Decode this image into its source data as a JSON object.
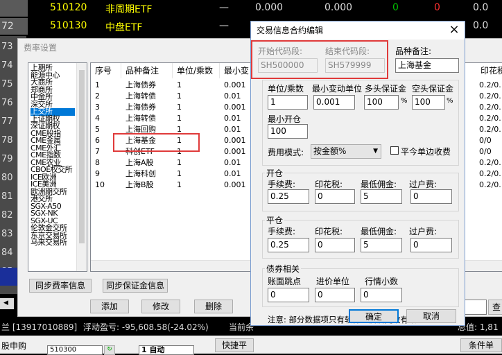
{
  "background_table": {
    "rows": [
      {
        "num": "",
        "code": "510120",
        "name": "非周期ETF",
        "c1": "—",
        "c2": "0.000",
        "c3": "0.000",
        "c4": "0",
        "c5": "0",
        "c6": "0.0"
      },
      {
        "num": "72",
        "code": "510130",
        "name": "中盘ETF",
        "c1": "—",
        "c2": "0.000",
        "c3": "",
        "c4": "",
        "c5": "",
        "c6": "0.0"
      }
    ],
    "left_numbers": [
      "73",
      "74",
      "75",
      "76",
      "77",
      "78",
      "79",
      "80",
      "81",
      "82",
      "83",
      "84",
      "85"
    ],
    "code_color": "#ffff00",
    "green": "#00c000",
    "red": "#ff3030"
  },
  "fee_window": {
    "title": "费率设置",
    "exchanges": [
      "上期所",
      "能源中心",
      "大商所",
      "郑商所",
      "中金所",
      "深交所",
      "上交所",
      "上证期权",
      "深证期权",
      "CME股指",
      "CME金属",
      "CME外汇",
      "CME指数",
      "CME农业",
      "CBOE权交所",
      "ICE欧洲",
      "ICE美洲",
      "欧洲期交所",
      "港交所",
      "SGX-A50",
      "SGX-NK",
      "SGX-UC",
      "伦敦金交所",
      "东京交易所",
      "马来交易所"
    ],
    "selected_exchange": "上交所",
    "columns": [
      "序号",
      "品种备注",
      "单位/乘数",
      "最小变"
    ],
    "rows": [
      {
        "no": "1",
        "name": "上海债券",
        "unit": "1",
        "min": "0.001"
      },
      {
        "no": "2",
        "name": "上海转债",
        "unit": "1",
        "min": "0.01"
      },
      {
        "no": "3",
        "name": "上海债券",
        "unit": "1",
        "min": "0.001"
      },
      {
        "no": "4",
        "name": "上海转债",
        "unit": "1",
        "min": "0.01"
      },
      {
        "no": "5",
        "name": "上海回购",
        "unit": "1",
        "min": "0.01"
      },
      {
        "no": "6",
        "name": "上海基金",
        "unit": "1",
        "min": "0.001"
      },
      {
        "no": "7",
        "name": "科创ETF",
        "unit": "1",
        "min": "0.001"
      },
      {
        "no": "8",
        "name": "上海A股",
        "unit": "1",
        "min": "0.01"
      },
      {
        "no": "9",
        "name": "上海科创",
        "unit": "1",
        "min": "0.01"
      },
      {
        "no": "10",
        "name": "上海B股",
        "unit": "1",
        "min": "0.001"
      }
    ],
    "right_column_header": "印花税",
    "right_column_values": [
      "0.2/0.",
      "0.2/0.",
      "0.2/0.",
      "0.2/0.",
      "0.2/0.",
      "0/0",
      "0/0",
      "0.2/0.",
      "0.2/0.",
      "0.2/0."
    ],
    "btn_sync_fee": "同步费率信息",
    "btn_sync_margin": "同步保证金信息",
    "btn_add": "添加",
    "btn_edit": "修改",
    "btn_delete": "删除",
    "btn_partial": "查"
  },
  "edit_dialog": {
    "title": "交易信息合约编辑",
    "close": "×",
    "start_code_label": "开始代码段:",
    "start_code_value": "SH500000",
    "end_code_label": "结束代码段:",
    "end_code_value": "SH579999",
    "remark_label": "品种备注:",
    "remark_value": "上海基金",
    "unit_label": "单位/乘数",
    "unit_value": "1",
    "min_change_label": "最小变动单位",
    "min_change_value": "0.001",
    "long_margin_label": "多头保证金",
    "long_margin_value": "100",
    "short_margin_label": "空头保证金",
    "short_margin_value": "100",
    "percent": "%",
    "min_open_label": "最小开仓",
    "min_open_value": "100",
    "fee_mode_label": "费用模式:",
    "fee_mode_value": "按金额%",
    "flat_today_label": "平今单边收费",
    "open_group": "开仓",
    "close_group": "平仓",
    "fee_label": "手续费:",
    "stamp_label": "印花税:",
    "min_comm_label": "最低佣金:",
    "transfer_label": "过户费:",
    "open_fee": "0.25",
    "open_stamp": "0",
    "open_min": "5",
    "open_transfer": "0",
    "close_fee": "0.25",
    "close_stamp": "0",
    "close_min": "5",
    "close_transfer": "0",
    "bond_group": "债券相关",
    "book_jump_label": "账面跳点",
    "price_unit_label": "进价单位",
    "quote_dec_label": "行情小数",
    "book_jump": "0",
    "price_unit": "0",
    "quote_dec": "0",
    "note": "注意: 部分数据项只有软件重启后更改有效。",
    "ok": "确定",
    "cancel": "取消"
  },
  "status_bar": {
    "account": "兰 [13917010889]",
    "float_pl": "浮动盈亏: -95,608.58(-24.02%)",
    "current": "当前余",
    "rate": "总值: 1,81",
    "stock": "股申购",
    "code": "510300",
    "auto": "1 自动",
    "quick": "快捷平",
    "cond": "条件单"
  }
}
